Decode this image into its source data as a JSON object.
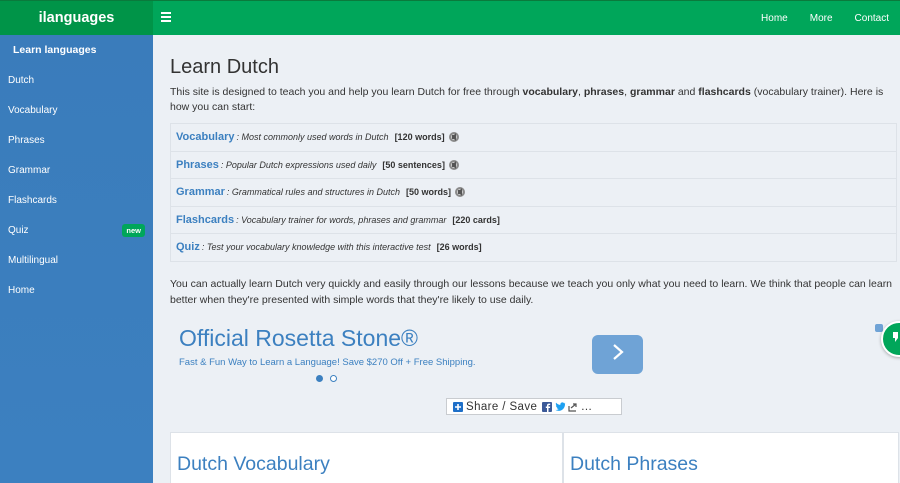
{
  "header": {
    "brand": "ilanguages",
    "nav": [
      "Home",
      "More",
      "Contact"
    ]
  },
  "sidebar": {
    "title": "Learn languages",
    "items": [
      {
        "label": "Dutch"
      },
      {
        "label": "Vocabulary"
      },
      {
        "label": "Phrases"
      },
      {
        "label": "Grammar"
      },
      {
        "label": "Flashcards"
      },
      {
        "label": "Quiz",
        "badge": "new"
      },
      {
        "label": "Multilingual"
      },
      {
        "label": "Home"
      }
    ]
  },
  "main": {
    "title": "Learn Dutch",
    "intro": {
      "t1": "This site is designed to teach you and help you learn Dutch for free through ",
      "b1": "vocabulary",
      "t2": ", ",
      "b2": "phrases",
      "t3": ", ",
      "b3": "grammar",
      "t4": " and ",
      "b4": "flashcards",
      "t5": " (vocabulary trainer). Here is how you can start:"
    },
    "lessons": [
      {
        "name": "Vocabulary",
        "desc": ": Most commonly used words in Dutch",
        "count": "[120 words]",
        "audio": true
      },
      {
        "name": "Phrases",
        "desc": ": Popular Dutch expressions used daily",
        "count": "[50 sentences]",
        "audio": true
      },
      {
        "name": "Grammar",
        "desc": ": Grammatical rules and structures in Dutch",
        "count": "[50 words]",
        "audio": true
      },
      {
        "name": "Flashcards",
        "desc": ": Vocabulary trainer for words, phrases and grammar",
        "count": "[220 cards]",
        "audio": false
      },
      {
        "name": "Quiz",
        "desc": ": Test your vocabulary knowledge with this interactive test",
        "count": "[26 words]",
        "audio": false
      }
    ],
    "paragraph": "You can actually learn Dutch very quickly and easily through our lessons because we teach you only what you need to learn. We think that people can learn better when they're presented with simple words that they're likely to use daily.",
    "ad": {
      "title": "Official Rosetta Stone®",
      "subtitle": "Fast & Fun Way to Learn a Language! Save $270 Off + Free Shipping."
    },
    "share": {
      "label": "Share / Save",
      "more": "..."
    },
    "cards": [
      {
        "title": "Dutch Vocabulary"
      },
      {
        "title": "Dutch Phrases"
      }
    ]
  },
  "colors": {
    "brand_green": "#00a65a",
    "sidebar_blue": "#3c80c0",
    "link_blue": "#3c80c0",
    "background": "#ecf0f5"
  }
}
